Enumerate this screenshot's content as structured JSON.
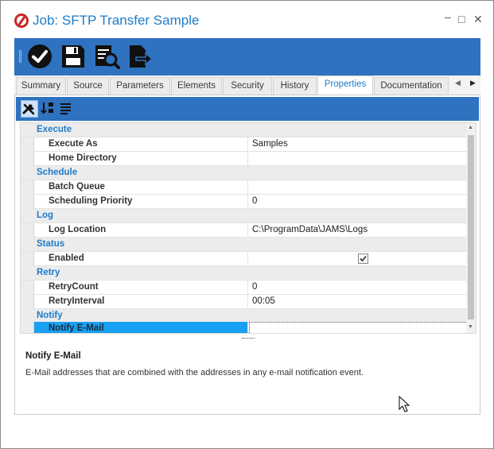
{
  "window": {
    "title": "Job: SFTP Transfer Sample",
    "controls": {
      "minimize": "–",
      "maximize": "□",
      "close": "✕"
    }
  },
  "toolbar": {
    "buttons": [
      {
        "icon": "checkmark-icon",
        "name": "submit-button"
      },
      {
        "icon": "save-icon",
        "name": "save-button"
      },
      {
        "icon": "report-search-icon",
        "name": "view-button"
      },
      {
        "icon": "export-icon",
        "name": "export-button"
      }
    ]
  },
  "tabs": [
    "Summary",
    "Source",
    "Parameters",
    "Elements",
    "Security",
    "History",
    "Properties",
    "Documentation"
  ],
  "active_tab": "Properties",
  "tab_nav": {
    "left": "◀",
    "right": "▶"
  },
  "property_grid": {
    "toolbar": [
      "categorized-icon",
      "sort-alpha-icon",
      "property-pages-icon"
    ],
    "categories": [
      {
        "name": "Execute",
        "props": [
          {
            "name": "Execute As",
            "value": "Samples"
          },
          {
            "name": "Home Directory",
            "value": ""
          }
        ]
      },
      {
        "name": "Schedule",
        "props": [
          {
            "name": "Batch Queue",
            "value": ""
          },
          {
            "name": "Scheduling Priority",
            "value": "0"
          }
        ]
      },
      {
        "name": "Log",
        "props": [
          {
            "name": "Log Location",
            "value": "C:\\ProgramData\\JAMS\\Logs"
          }
        ]
      },
      {
        "name": "Status",
        "props": [
          {
            "name": "Enabled",
            "value": "",
            "checked": true
          }
        ]
      },
      {
        "name": "Retry",
        "props": [
          {
            "name": "RetryCount",
            "value": "0"
          },
          {
            "name": "RetryInterval",
            "value": "00:05"
          }
        ]
      },
      {
        "name": "Notify",
        "props": [
          {
            "name": "Notify E-Mail",
            "value": "",
            "selected": true
          }
        ]
      }
    ]
  },
  "help": {
    "title": "Notify E-Mail",
    "description": "E-Mail addresses that are combined with the addresses in any e-mail notification event."
  },
  "colors": {
    "accent": "#1e7bc9",
    "toolbar": "#2e72c0",
    "selection": "#1aa0f2"
  }
}
